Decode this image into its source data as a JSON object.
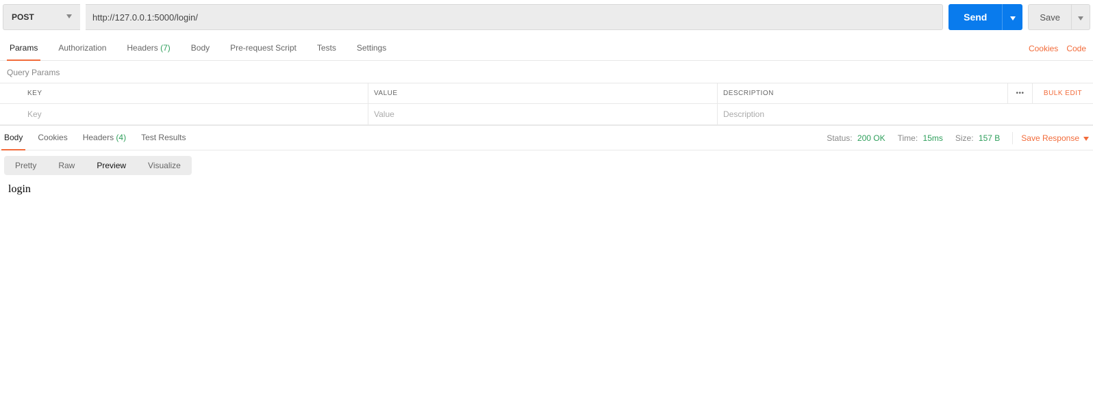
{
  "request": {
    "method": "POST",
    "url": "http://127.0.0.1:5000/login/",
    "send_label": "Send",
    "save_label": "Save"
  },
  "req_tabs": {
    "params": "Params",
    "authorization": "Authorization",
    "headers_label": "Headers",
    "headers_count": "(7)",
    "body": "Body",
    "prerequest": "Pre-request Script",
    "tests": "Tests",
    "settings": "Settings",
    "cookies_link": "Cookies",
    "code_link": "Code"
  },
  "query_params": {
    "title": "Query Params",
    "col_key": "KEY",
    "col_value": "VALUE",
    "col_description": "DESCRIPTION",
    "bulk_edit": "Bulk Edit",
    "placeholders": {
      "key": "Key",
      "value": "Value",
      "description": "Description"
    }
  },
  "resp_tabs": {
    "body": "Body",
    "cookies": "Cookies",
    "headers_label": "Headers",
    "headers_count": "(4)",
    "test_results": "Test Results"
  },
  "resp_meta": {
    "status_label": "Status:",
    "status_value": "200 OK",
    "time_label": "Time:",
    "time_value": "15ms",
    "size_label": "Size:",
    "size_value": "157 B",
    "save_response": "Save Response"
  },
  "view_modes": {
    "pretty": "Pretty",
    "raw": "Raw",
    "preview": "Preview",
    "visualize": "Visualize"
  },
  "response_body_preview": "login"
}
